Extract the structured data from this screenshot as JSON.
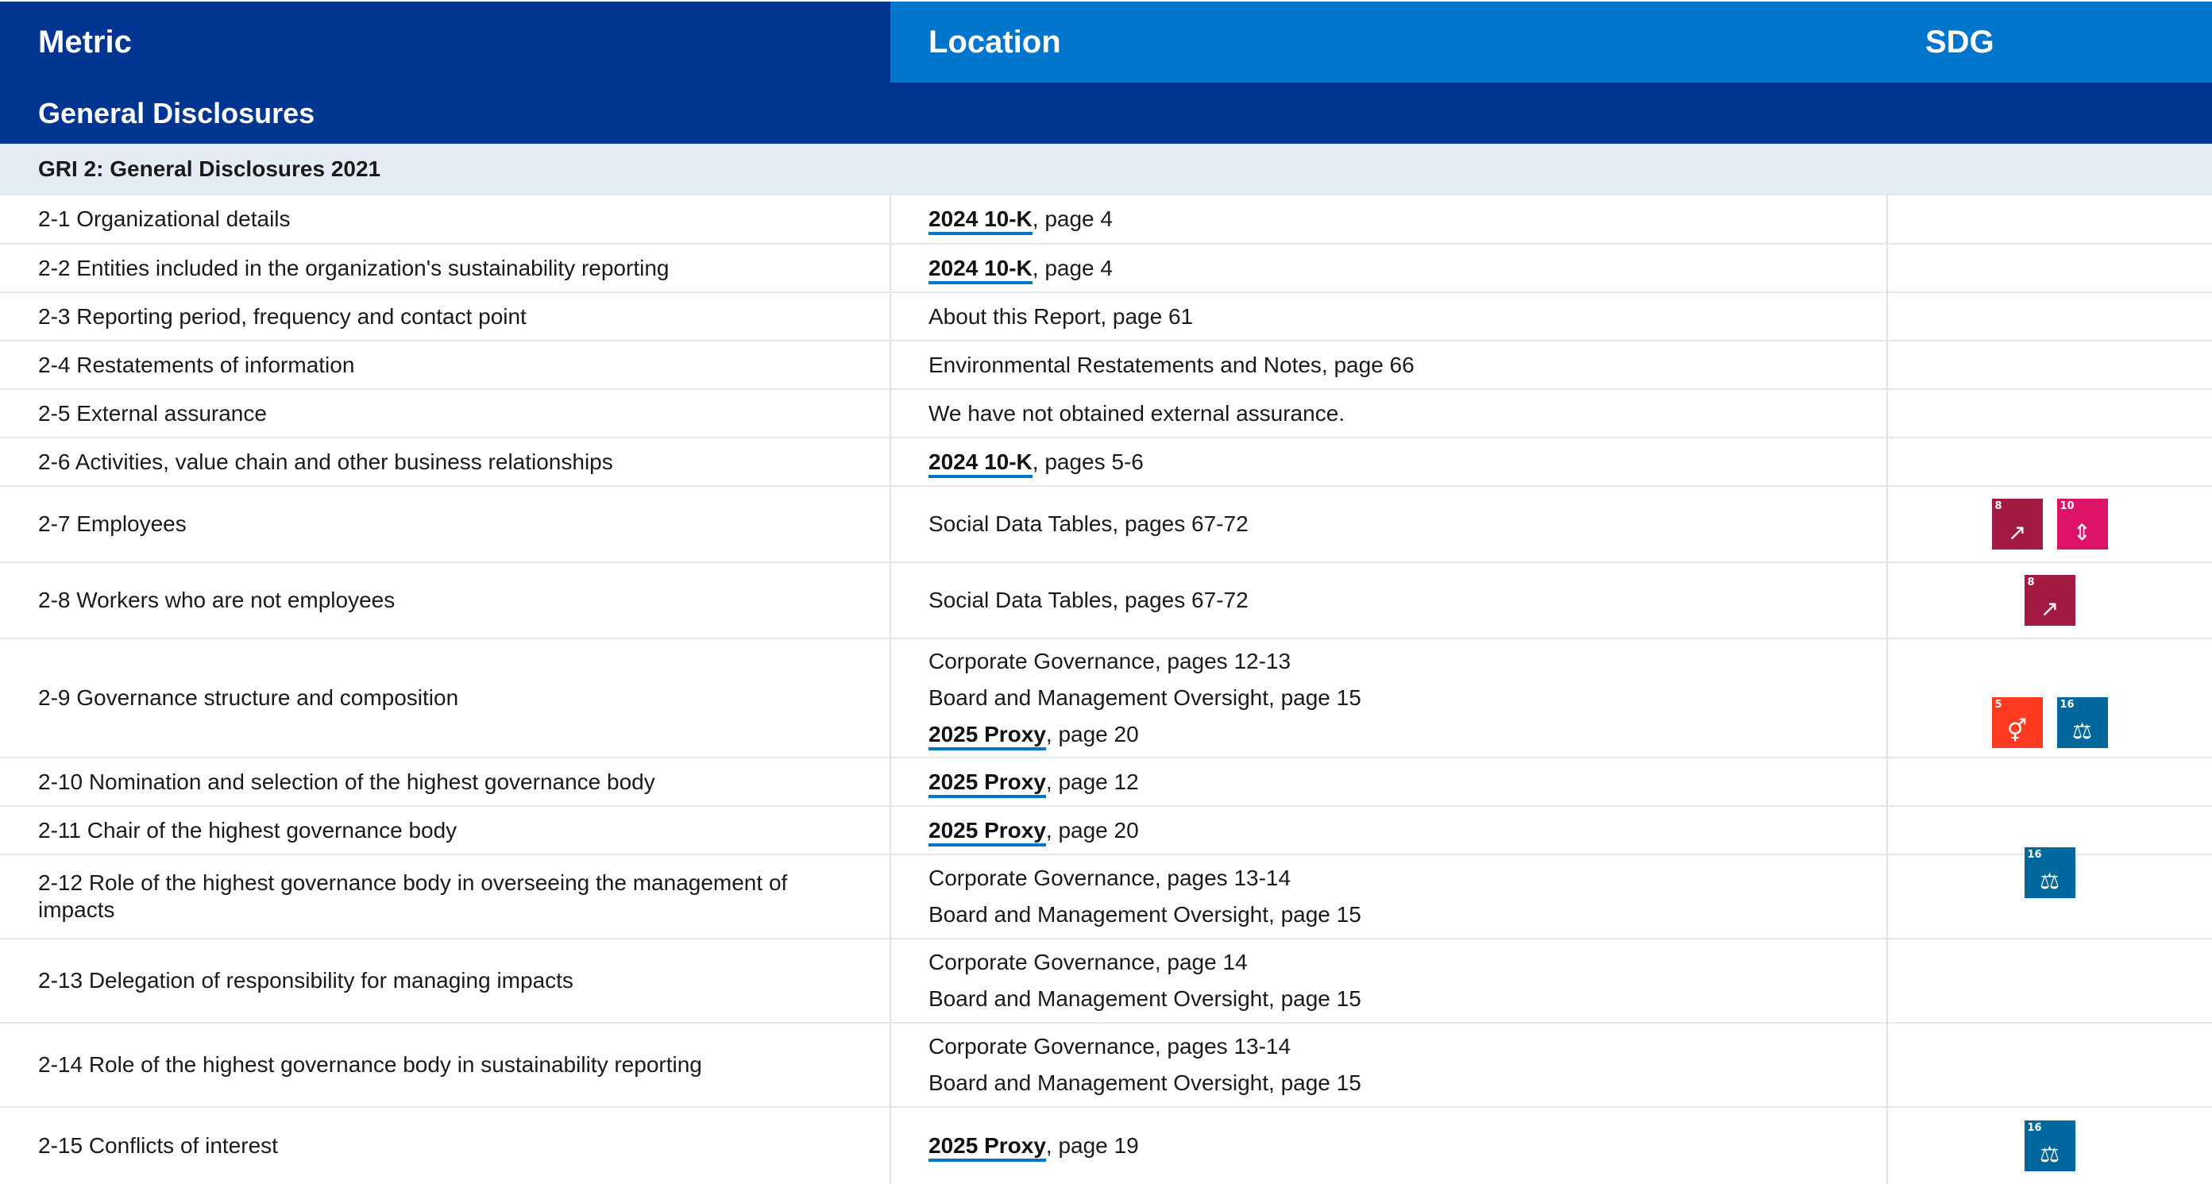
{
  "header": {
    "metric": "Metric",
    "location": "Location",
    "sdg": "SDG"
  },
  "section": {
    "title": "General Disclosures"
  },
  "subsection": {
    "title": "GRI 2: General Disclosures 2021"
  },
  "rows": [
    {
      "metric": "2-1 Organizational details",
      "loc": [
        {
          "link": "2024 10-K",
          "text": ", page 4"
        }
      ]
    },
    {
      "metric": "2-2 Entities included in the organization's sustainability reporting",
      "loc": [
        {
          "link": "2024 10-K",
          "text": ", page 4"
        }
      ]
    },
    {
      "metric": "2-3 Reporting period, frequency and contact point",
      "loc": [
        {
          "text": "About this Report, page 61"
        }
      ]
    },
    {
      "metric": "2-4 Restatements of information",
      "loc": [
        {
          "text": "Environmental Restatements and Notes, page 66"
        }
      ]
    },
    {
      "metric": "2-5 External assurance",
      "loc": [
        {
          "text": "We have not obtained external assurance."
        }
      ]
    },
    {
      "metric": "2-6 Activities, value chain and other business relationships",
      "loc": [
        {
          "link": "2024 10-K",
          "text": ", pages 5-6"
        }
      ]
    },
    {
      "metric": "2-7 Employees",
      "loc": [
        {
          "text": "Social Data Tables, pages 67-72"
        }
      ]
    },
    {
      "metric": "2-8 Workers who are not employees",
      "loc": [
        {
          "text": "Social Data Tables, pages 67-72"
        }
      ]
    },
    {
      "metric": "2-9 Governance structure and composition",
      "loc": [
        {
          "text": "Corporate Governance, pages 12-13"
        },
        {
          "text": "Board and Management Oversight, page 15"
        },
        {
          "link": "2025 Proxy",
          "text": ", page 20"
        }
      ]
    },
    {
      "metric": "2-10 Nomination and selection of the highest governance body",
      "loc": [
        {
          "link": "2025 Proxy",
          "text": ", page 12"
        }
      ]
    },
    {
      "metric": "2-11 Chair of the highest governance body",
      "loc": [
        {
          "link": "2025 Proxy",
          "text": ", page 20"
        }
      ]
    },
    {
      "metric": "2-12 Role of the highest governance body in overseeing the management of impacts",
      "loc": [
        {
          "text": "Corporate Governance, pages 13-14"
        },
        {
          "text": "Board and Management Oversight, page 15"
        }
      ]
    },
    {
      "metric": "2-13 Delegation of responsibility for managing impacts",
      "loc": [
        {
          "text": "Corporate Governance, page 14"
        },
        {
          "text": "Board and Management Oversight, page 15"
        }
      ]
    },
    {
      "metric": "2-14 Role of the highest governance body in sustainability reporting",
      "loc": [
        {
          "text": "Corporate Governance, pages 13-14"
        },
        {
          "text": "Board and Management Oversight, page 15"
        }
      ]
    },
    {
      "metric": "2-15 Conflicts of interest",
      "loc": [
        {
          "link": "2025 Proxy",
          "text": ", page 19"
        }
      ]
    }
  ],
  "sdg_groups": [
    {
      "icons": [
        {
          "goal": "8",
          "icon": "decent-work-economic-growth-icon",
          "color": "#a21942"
        },
        {
          "goal": "10",
          "icon": "reduced-inequalities-icon",
          "color": "#dd1367"
        }
      ]
    },
    {
      "icons": [
        {
          "goal": "8",
          "icon": "decent-work-economic-growth-icon",
          "color": "#a21942"
        }
      ]
    },
    {
      "icons": [
        {
          "goal": "5",
          "icon": "gender-equality-icon",
          "color": "#ff3a21"
        },
        {
          "goal": "16",
          "icon": "peace-justice-strong-institutions-icon",
          "color": "#00689d"
        }
      ]
    },
    {
      "icons": [
        {
          "goal": "16",
          "icon": "peace-justice-strong-institutions-icon",
          "color": "#00689d"
        }
      ]
    },
    {
      "icons": [
        {
          "goal": "16",
          "icon": "peace-justice-strong-institutions-icon",
          "color": "#00689d"
        }
      ]
    }
  ]
}
